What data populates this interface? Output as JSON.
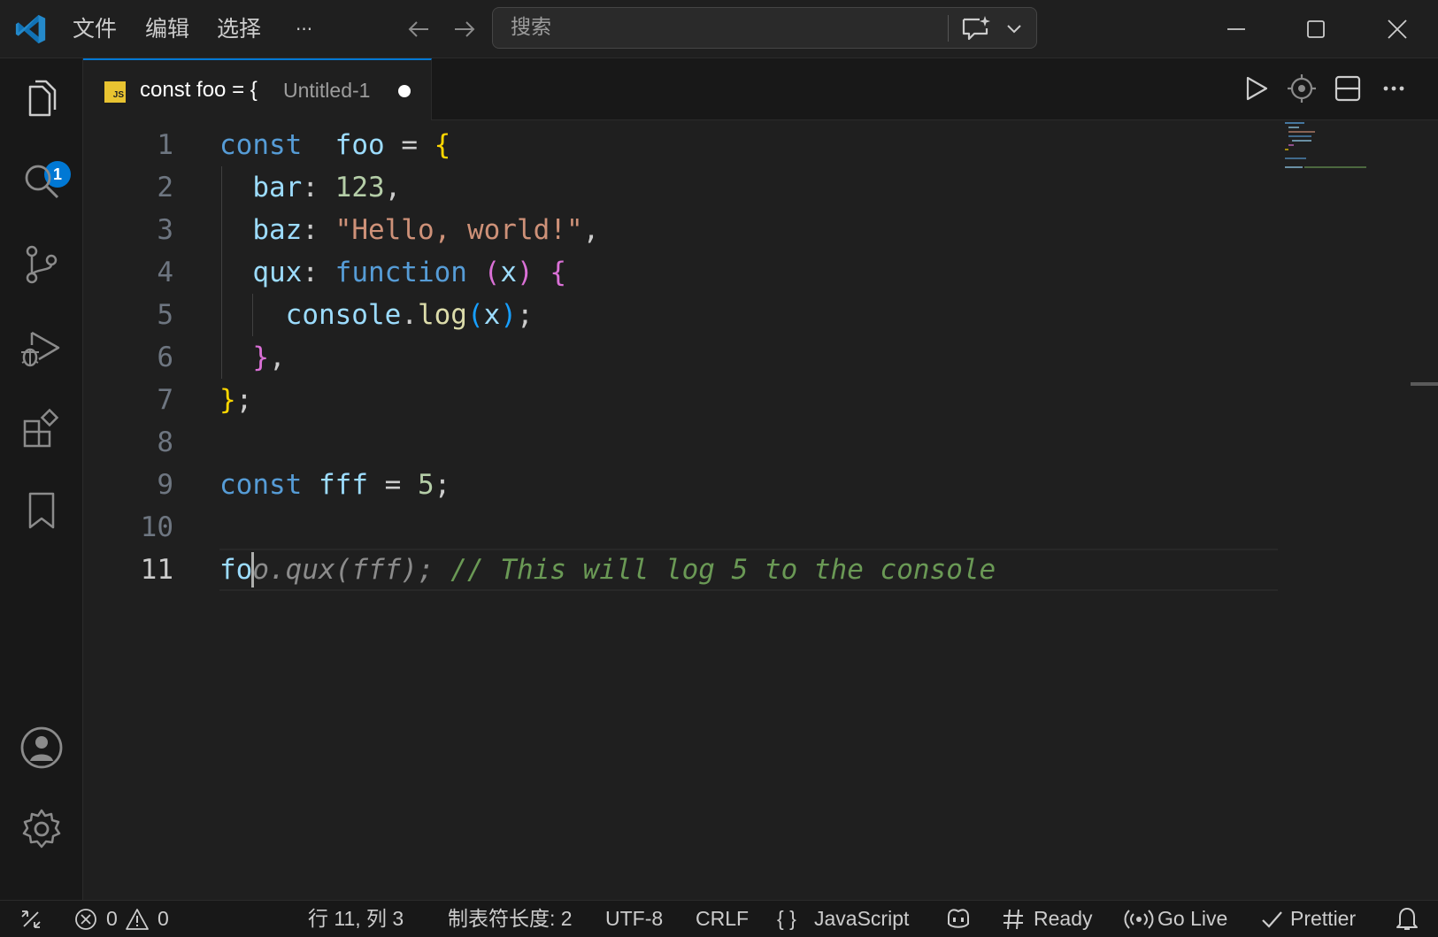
{
  "titlebar": {
    "menu": [
      "文件",
      "编辑",
      "选择",
      "···"
    ],
    "search_placeholder": "搜索"
  },
  "activity_bar": {
    "items": [
      "explorer-icon",
      "search-icon",
      "source-control-icon",
      "run-debug-icon",
      "extensions-icon",
      "bookmark-icon"
    ],
    "explorer_badge": "1",
    "bottom": [
      "account-icon",
      "settings-gear-icon"
    ]
  },
  "tab": {
    "language_icon": "JS",
    "title": "const foo = {",
    "subtitle": "Untitled-1",
    "dirty": true
  },
  "editor": {
    "line_numbers": [
      "1",
      "2",
      "3",
      "4",
      "5",
      "6",
      "7",
      "8",
      "9",
      "10",
      "11"
    ],
    "active_line": 11,
    "lines": [
      [
        [
          "kw",
          "const"
        ],
        [
          "",
          "  "
        ],
        [
          "var",
          "foo"
        ],
        [
          "",
          " = "
        ],
        [
          "b1",
          "{"
        ]
      ],
      [
        [
          "",
          ""
        ],
        [
          "",
          "  "
        ],
        [
          "var",
          "bar"
        ],
        [
          "",
          ": "
        ],
        [
          "num",
          "123"
        ],
        [
          "",
          ","
        ]
      ],
      [
        [
          "",
          "  "
        ],
        [
          "var",
          "baz"
        ],
        [
          "",
          ": "
        ],
        [
          "str",
          "\"Hello, world!\""
        ],
        [
          "",
          ","
        ]
      ],
      [
        [
          "",
          "  "
        ],
        [
          "var",
          "qux"
        ],
        [
          "",
          ": "
        ],
        [
          "kw",
          "function"
        ],
        [
          "",
          " "
        ],
        [
          "b2",
          "("
        ],
        [
          "var",
          "x"
        ],
        [
          "b2",
          ")"
        ],
        [
          "",
          " "
        ],
        [
          "b2",
          "{"
        ]
      ],
      [
        [
          "",
          "    "
        ],
        [
          "var",
          "console"
        ],
        [
          "",
          "."
        ],
        [
          "fn",
          "log"
        ],
        [
          "b3",
          "("
        ],
        [
          "var",
          "x"
        ],
        [
          "b3",
          ")"
        ],
        [
          "",
          ";"
        ]
      ],
      [
        [
          "",
          "  "
        ],
        [
          "b2",
          "}"
        ],
        [
          "",
          ","
        ]
      ],
      [
        [
          "b1",
          "}"
        ],
        [
          "",
          ";"
        ]
      ],
      [],
      [
        [
          "kw",
          "const"
        ],
        [
          "",
          " "
        ],
        [
          "var",
          "fff"
        ],
        [
          "",
          " = "
        ],
        [
          "num",
          "5"
        ],
        [
          "",
          ";"
        ]
      ],
      [],
      [
        [
          "var",
          "fo"
        ],
        [
          "ghost",
          "o.qux(fff); "
        ],
        [
          "cm",
          "// This will log 5 to the console"
        ]
      ]
    ]
  },
  "statusbar": {
    "errors": "0",
    "warnings": "0",
    "position": "行 11, 列 3",
    "tab_size": "制表符长度: 2",
    "encoding": "UTF-8",
    "eol": "CRLF",
    "language": "JavaScript",
    "language_braces": "{ }",
    "ready": "Ready",
    "go_live": "Go Live",
    "prettier": "Prettier"
  },
  "colors": {
    "accent": "#0078d4",
    "background": "#1f1f1f",
    "sidebar": "#181818"
  }
}
